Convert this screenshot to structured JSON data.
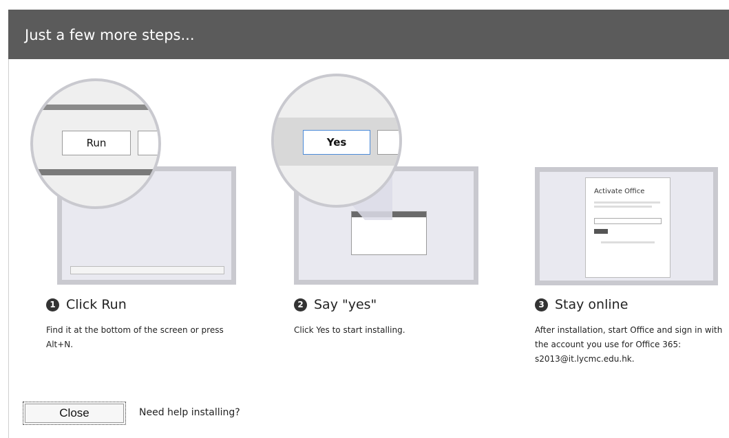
{
  "dialog": {
    "title": "Just a few more steps..."
  },
  "steps": [
    {
      "number": "1",
      "heading": "Click Run",
      "description": "Find it at the bottom of the screen or press Alt+N.",
      "zoom_button": "Run"
    },
    {
      "number": "2",
      "heading": "Say \"yes\"",
      "description": "Click Yes to start installing.",
      "zoom_button": "Yes"
    },
    {
      "number": "3",
      "heading": "Stay online",
      "description": "After installation, start Office and sign in with the account you use for Office 365: s2013@it.lycmc.edu.hk.",
      "screen_title": "Activate Office"
    }
  ],
  "footer": {
    "close_label": "Close",
    "help_link": "Need help installing?"
  }
}
